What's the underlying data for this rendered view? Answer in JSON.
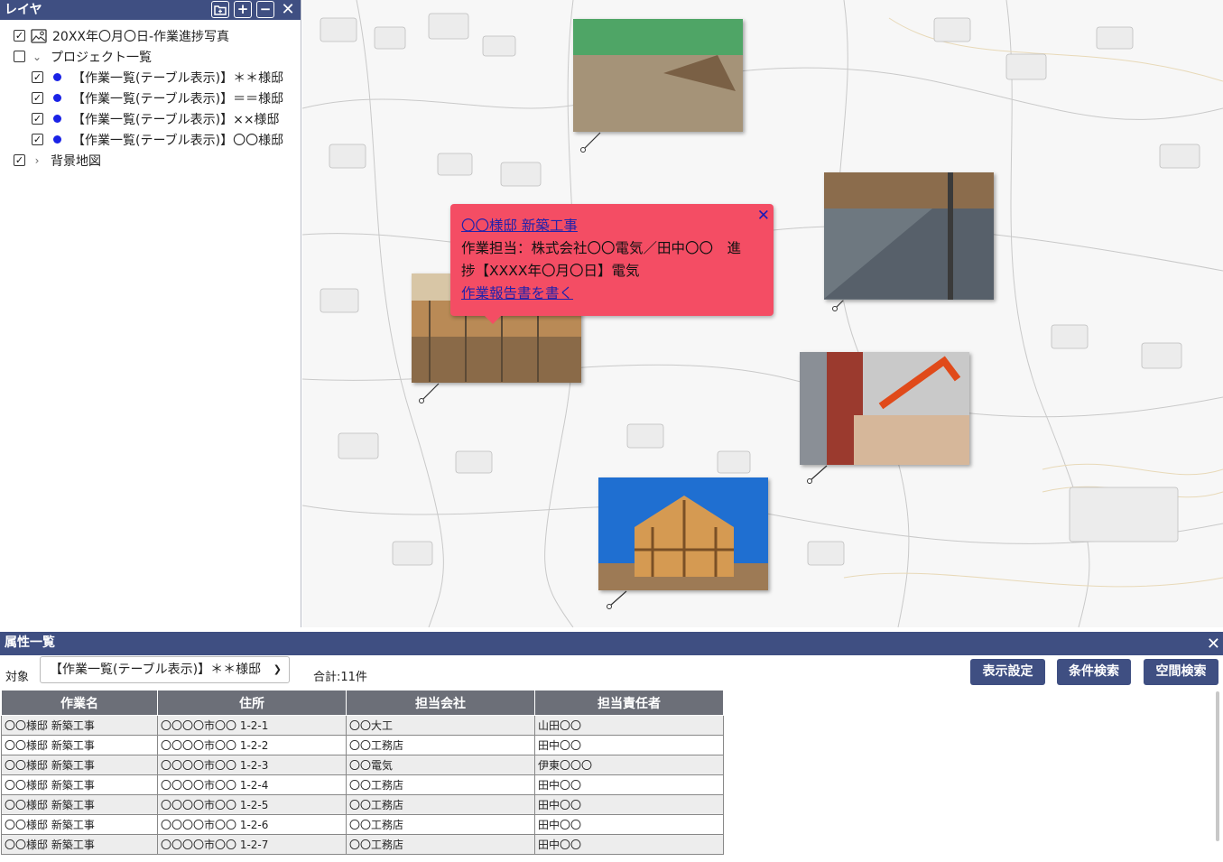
{
  "layer_panel": {
    "title": "レイヤ",
    "items": {
      "photos": "20XX年〇月〇日-作業進捗写真",
      "project_list": "プロジェクト一覧",
      "sub1": "【作業一覧(テーブル表示)】＊＊様邸",
      "sub2": "【作業一覧(テーブル表示)】＝＝様邸",
      "sub3": "【作業一覧(テーブル表示)】××様邸",
      "sub4": "【作業一覧(テーブル表示)】〇〇様邸",
      "background_map": "背景地図"
    }
  },
  "popup": {
    "title": "〇〇様邸 新築工事",
    "line1": "作業担当：株式会社〇〇電気／田中〇〇　進",
    "line2": "捗【XXXX年〇月〇日】電気",
    "link": "作業報告書を書く"
  },
  "attr_panel": {
    "title": "属性一覧",
    "target_label": "対象",
    "target_value": "【作業一覧(テーブル表示)】＊＊様邸",
    "total": "合計:11件",
    "buttons": {
      "display": "表示設定",
      "condition": "条件検索",
      "spatial": "空間検索"
    },
    "columns": [
      "作業名",
      "住所",
      "担当会社",
      "担当責任者"
    ],
    "rows": [
      [
        "〇〇様邸 新築工事",
        "〇〇〇〇市〇〇 1-2-1",
        "〇〇大工",
        "山田〇〇"
      ],
      [
        "〇〇様邸 新築工事",
        "〇〇〇〇市〇〇 1-2-2",
        "〇〇工務店",
        "田中〇〇"
      ],
      [
        "〇〇様邸 新築工事",
        "〇〇〇〇市〇〇 1-2-3",
        "〇〇電気",
        "伊東〇〇〇"
      ],
      [
        "〇〇様邸 新築工事",
        "〇〇〇〇市〇〇 1-2-4",
        "〇〇工務店",
        "田中〇〇"
      ],
      [
        "〇〇様邸 新築工事",
        "〇〇〇〇市〇〇 1-2-5",
        "〇〇工務店",
        "田中〇〇"
      ],
      [
        "〇〇様邸 新築工事",
        "〇〇〇〇市〇〇 1-2-6",
        "〇〇工務店",
        "田中〇〇"
      ],
      [
        "〇〇様邸 新築工事",
        "〇〇〇〇市〇〇 1-2-7",
        "〇〇工務店",
        "田中〇〇"
      ]
    ]
  },
  "colors": {
    "header": "#3f4f82",
    "popup": "#f44d64",
    "layer_dot": "#1a22e6"
  }
}
